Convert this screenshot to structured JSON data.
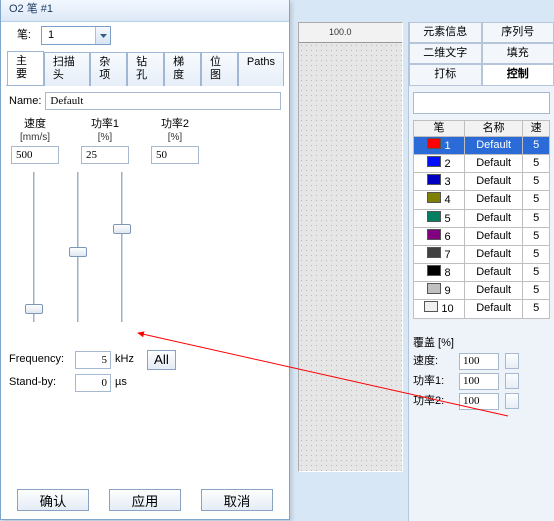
{
  "window": {
    "title": "O2 笔 #1"
  },
  "pen": {
    "label": "笔:",
    "selected": "1"
  },
  "tabs": [
    "主要",
    "扫描头",
    "杂项",
    "钻孔",
    "梯度",
    "位图",
    "Paths"
  ],
  "active_tab": 0,
  "name": {
    "label": "Name:",
    "value": "Default"
  },
  "cols": [
    {
      "h1": "速度",
      "h2": "[mm/s]",
      "val": "500",
      "thumb_pct": 88
    },
    {
      "h1": "功率1",
      "h2": "[%]",
      "val": "25",
      "thumb_pct": 50
    },
    {
      "h1": "功率2",
      "h2": "[%]",
      "val": "50",
      "thumb_pct": 35
    }
  ],
  "freq": {
    "label": "Frequency:",
    "value": "5",
    "unit": "kHz"
  },
  "standby": {
    "label": "Stand-by:",
    "value": "0",
    "unit": "µs"
  },
  "all_btn": "All",
  "buttons": {
    "ok": "确认",
    "apply": "应用",
    "cancel": "取消"
  },
  "ruler": {
    "center_label": "100.0"
  },
  "right_tabs_row1": [
    "元素信息",
    "序列号"
  ],
  "right_tabs_row2": [
    "二维文字",
    "填充"
  ],
  "right_tabs_row3": [
    "打标",
    "控制"
  ],
  "right_active": "控制",
  "pen_table": {
    "headers": [
      "笔",
      "名称",
      "速"
    ],
    "rows": [
      {
        "n": "1",
        "name": "Default",
        "v": "5",
        "color": "#ff0000",
        "sel": true
      },
      {
        "n": "2",
        "name": "Default",
        "v": "5",
        "color": "#0010ff"
      },
      {
        "n": "3",
        "name": "Default",
        "v": "5",
        "color": "#0000c0"
      },
      {
        "n": "4",
        "name": "Default",
        "v": "5",
        "color": "#808000"
      },
      {
        "n": "5",
        "name": "Default",
        "v": "5",
        "color": "#008060"
      },
      {
        "n": "6",
        "name": "Default",
        "v": "5",
        "color": "#800080"
      },
      {
        "n": "7",
        "name": "Default",
        "v": "5",
        "color": "#404040"
      },
      {
        "n": "8",
        "name": "Default",
        "v": "5",
        "color": "#000000"
      },
      {
        "n": "9",
        "name": "Default",
        "v": "5",
        "color": "#c0c0c0"
      },
      {
        "n": "10",
        "name": "Default",
        "v": "5",
        "color": "#f0f0f0"
      }
    ]
  },
  "override": {
    "title": "覆盖 [%]",
    "rows": [
      {
        "label": "速度:",
        "value": "100"
      },
      {
        "label": "功率1:",
        "value": "100"
      },
      {
        "label": "功率2:",
        "value": "100"
      }
    ]
  }
}
